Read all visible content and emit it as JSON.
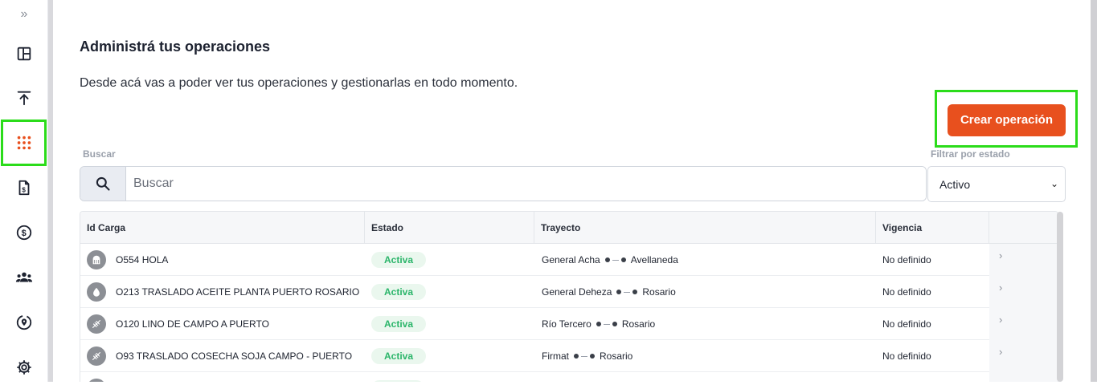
{
  "sidebar": {
    "collapse_glyph": "»",
    "items": [
      {
        "icon": "dashboard-icon"
      },
      {
        "icon": "upload-icon"
      },
      {
        "icon": "grid-dots-icon",
        "active": true
      },
      {
        "icon": "invoice-icon"
      },
      {
        "icon": "dollar-icon"
      },
      {
        "icon": "users-icon"
      },
      {
        "icon": "location-icon"
      },
      {
        "icon": "gear-icon"
      }
    ]
  },
  "header": {
    "title": "Administrá tus operaciones",
    "subtitle": "Desde acá vas a poder ver tus operaciones y gestionarlas en todo momento."
  },
  "actions": {
    "create_label": "Crear operación"
  },
  "search": {
    "label": "Buscar",
    "placeholder": "Buscar",
    "value": ""
  },
  "filter": {
    "label": "Filtrar por estado",
    "selected": "Activo"
  },
  "table": {
    "columns": [
      "Id Carga",
      "Estado",
      "Trayecto",
      "Vigencia",
      ""
    ],
    "rows": [
      {
        "icon": "silo-icon",
        "id": "O554 HOLA",
        "estado": "Activa",
        "origen": "General Acha",
        "destino": "Avellaneda",
        "vigencia": "No definido"
      },
      {
        "icon": "drop-icon",
        "id": "O213 TRASLADO ACEITE PLANTA PUERTO ROSARIO",
        "estado": "Activa",
        "origen": "General Deheza",
        "destino": "Rosario",
        "vigencia": "No definido"
      },
      {
        "icon": "wheat-icon",
        "id": "O120 LINO DE CAMPO A PUERTO",
        "estado": "Activa",
        "origen": "Río Tercero",
        "destino": "Rosario",
        "vigencia": "No definido"
      },
      {
        "icon": "wheat-icon",
        "id": "O93 TRASLADO COSECHA SOJA CAMPO - PUERTO",
        "estado": "Activa",
        "origen": "Firmat",
        "destino": "Rosario",
        "vigencia": "No definido"
      }
    ]
  },
  "colors": {
    "accent": "#e8501e",
    "active_green": "#2bb56a",
    "highlight": "#2bdc1a"
  }
}
